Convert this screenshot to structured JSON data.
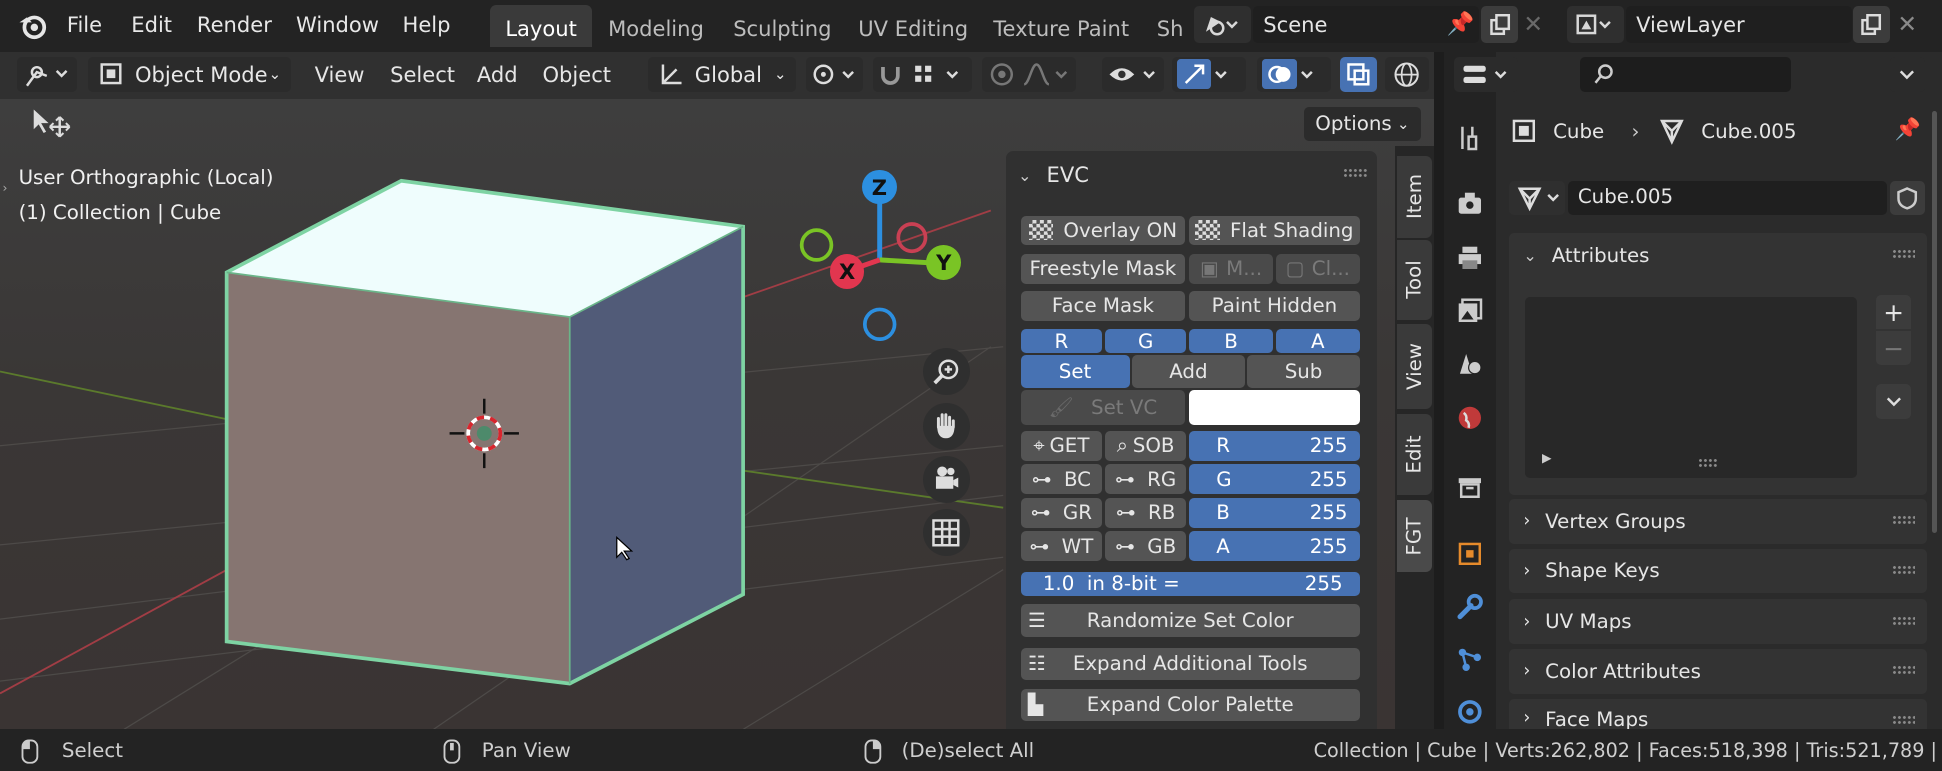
{
  "topbar": {
    "menus": [
      "File",
      "Edit",
      "Render",
      "Window",
      "Help"
    ],
    "workspaces": [
      "Layout",
      "Modeling",
      "Sculpting",
      "UV Editing",
      "Texture Paint",
      "Sh"
    ],
    "active_workspace": "Layout",
    "scene": "Scene",
    "view_layer": "ViewLayer"
  },
  "viewport_header": {
    "mode": "Object Mode",
    "menus": [
      "View",
      "Select",
      "Add",
      "Object"
    ],
    "orientation": "Global",
    "options_label": "Options"
  },
  "viewport": {
    "view_name": "User Orthographic (Local)",
    "collection_info": "(1) Collection | Cube",
    "gizmo": {
      "x": "X",
      "y": "Y",
      "z": "Z"
    }
  },
  "evc": {
    "title": "EVC",
    "overlay_btn": "Overlay ON",
    "flat_btn": "Flat Shading",
    "freestyle_btn": "Freestyle Mask",
    "m_btn": "M...",
    "cl_btn": "Cl...",
    "face_mask": "Face Mask",
    "paint_hidden": "Paint Hidden",
    "channels": [
      "R",
      "G",
      "B",
      "A"
    ],
    "modes": [
      "Set",
      "Add",
      "Sub"
    ],
    "set_vc": "Set VC",
    "get_label": "GET",
    "sob_label": "SOB",
    "swatch_color": "#ffffff",
    "toggles": [
      [
        "BC",
        "RG"
      ],
      [
        "GR",
        "RB"
      ],
      [
        "WT",
        "GB"
      ]
    ],
    "rgba_values": [
      {
        "label": "R",
        "value": "255"
      },
      {
        "label": "G",
        "value": "255"
      },
      {
        "label": "B",
        "value": "255"
      },
      {
        "label": "A",
        "value": "255"
      }
    ],
    "eightbit_label": "1.0  in 8-bit =",
    "eightbit_value": "255",
    "randomize": "Randomize Set Color",
    "expand_tools": "Expand Additional Tools",
    "expand_palette": "Expand Color Palette"
  },
  "sidebar_tabs": [
    "Item",
    "Tool",
    "View",
    "Edit",
    "FGT"
  ],
  "properties": {
    "breadcrumb_object": "Cube",
    "breadcrumb_data": "Cube.005",
    "mesh_name": "Cube.005",
    "sections": [
      "Attributes",
      "Vertex Groups",
      "Shape Keys",
      "UV Maps",
      "Color Attributes",
      "Face Maps"
    ]
  },
  "status": {
    "select": "Select",
    "pan": "Pan View",
    "deselect": "(De)select All",
    "stats": "Collection | Cube | Verts:262,802 | Faces:518,398 | Tris:521,789 |"
  },
  "colors": {
    "accent_blue": "#4772b3",
    "selection_outline": "#6fcf97",
    "axis_x": "#e2364f",
    "axis_y": "#7ac425",
    "axis_z": "#2c8fe0"
  }
}
